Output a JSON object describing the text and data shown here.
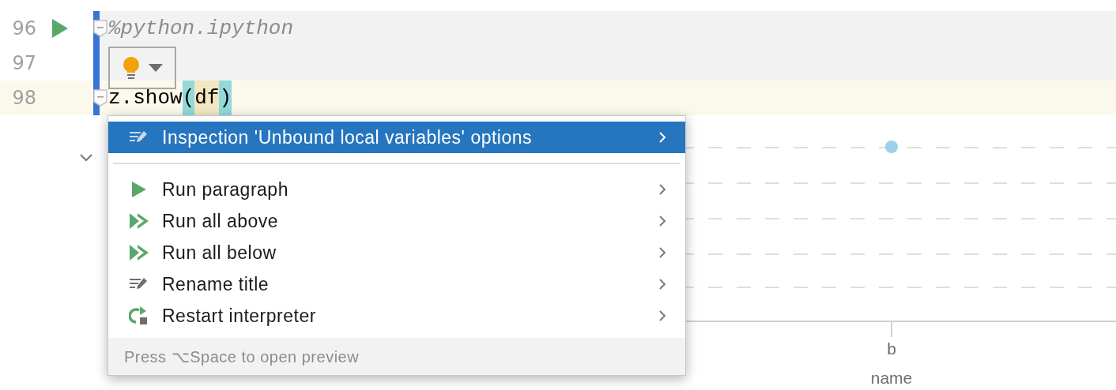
{
  "editor": {
    "lines": [
      {
        "number": "96",
        "run_button": true,
        "fold": true,
        "current": false,
        "segments": [
          {
            "text": "%python.ipython",
            "kind": "directive"
          }
        ]
      },
      {
        "number": "97",
        "run_button": false,
        "fold": false,
        "current": false
      },
      {
        "number": "98",
        "run_button": false,
        "fold": true,
        "current": true,
        "segments": [
          {
            "text": "z.show",
            "kind": "plain"
          },
          {
            "text": "(",
            "kind": "brace"
          },
          {
            "text": "df",
            "kind": "ref"
          },
          {
            "text": ")",
            "kind": "brace"
          }
        ]
      }
    ]
  },
  "chart": {
    "category": "b",
    "xlabel": "name"
  },
  "context_menu": {
    "items": [
      {
        "label": "Inspection 'Unbound local variables' options",
        "kind": "edit",
        "selected": true
      },
      {
        "label": "Run paragraph",
        "kind": "run",
        "selected": false
      },
      {
        "label": "Run all above",
        "kind": "run-all",
        "selected": false
      },
      {
        "label": "Run all below",
        "kind": "run-all",
        "selected": false
      },
      {
        "label": "Rename title",
        "kind": "edit",
        "selected": false
      },
      {
        "label": "Restart interpreter",
        "kind": "restart",
        "selected": false
      }
    ],
    "footer": "Press ⌥Space to open preview"
  }
}
